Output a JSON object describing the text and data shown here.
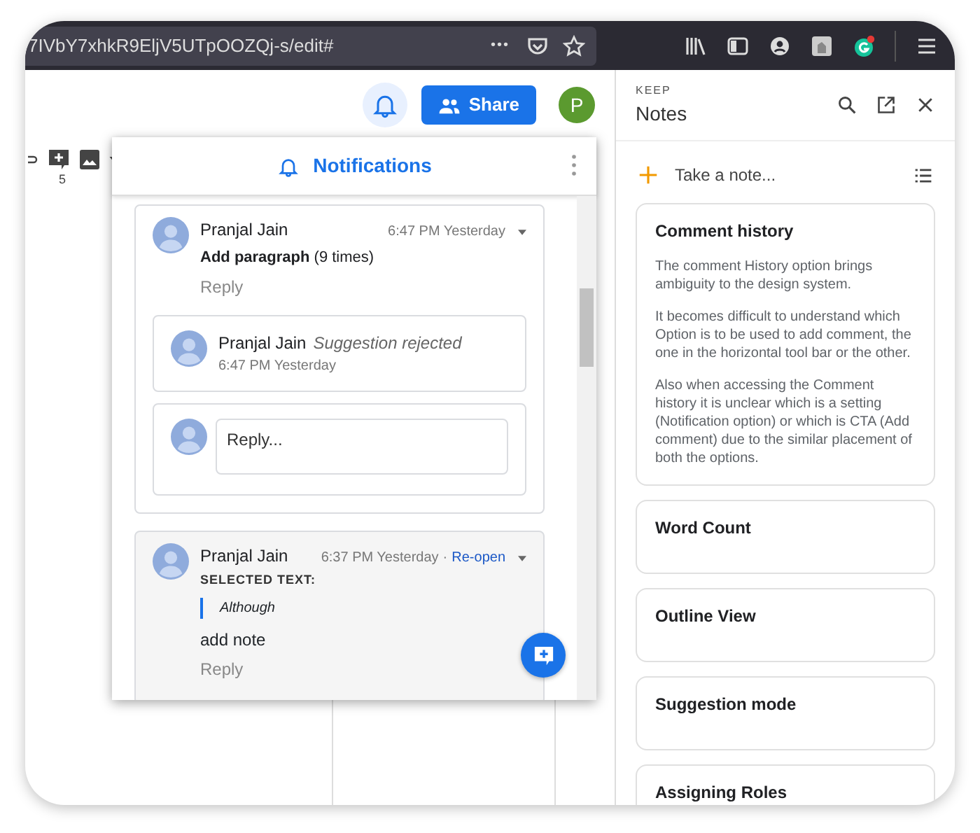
{
  "browser": {
    "url": "7IVbY7xhkR9EljV5UTpOOZQj-s/edit#",
    "menu_dots": "•••"
  },
  "doc": {
    "share_label": "Share",
    "avatar_initial": "P",
    "ruler_mark": "5"
  },
  "notifications": {
    "title": "Notifications",
    "threads": [
      {
        "resolved": false,
        "author": "Pranjal Jain",
        "time": "6:47 PM Yesterday",
        "action": "**Add paragraph** (9 times)",
        "reply_link": "Reply",
        "replies": [
          {
            "author": "Pranjal Jain",
            "status": "Suggestion rejected",
            "time": "6:47 PM Yesterday"
          }
        ],
        "reply_field": {
          "placeholder": "Reply..."
        }
      },
      {
        "resolved": true,
        "author": "Pranjal Jain",
        "time": "6:37 PM Yesterday",
        "separator": "·",
        "reopen": "Re-open",
        "selected_label": "SELECTED TEXT:",
        "quote": "Although",
        "body": "add note",
        "reply_link": "Reply"
      }
    ]
  },
  "keep": {
    "brand": "KEEP",
    "title": "Notes",
    "take_note": {
      "placeholder": "Take a note..."
    },
    "notes": [
      {
        "title": "Comment history",
        "paragraphs": [
          "The comment History option brings ambiguity to the design system.",
          "It becomes difficult to understand which Option is to be used to add comment, the one in the horizontal tool bar or the other.",
          "Also when accessing the Comment history it is unclear which is a setting (Notification option) or which is CTA (Add comment) due to the similar placement of both the options."
        ]
      },
      {
        "title": "Word Count"
      },
      {
        "title": "Outline View"
      },
      {
        "title": "Suggestion mode"
      },
      {
        "title": "Assigning Roles"
      }
    ]
  }
}
